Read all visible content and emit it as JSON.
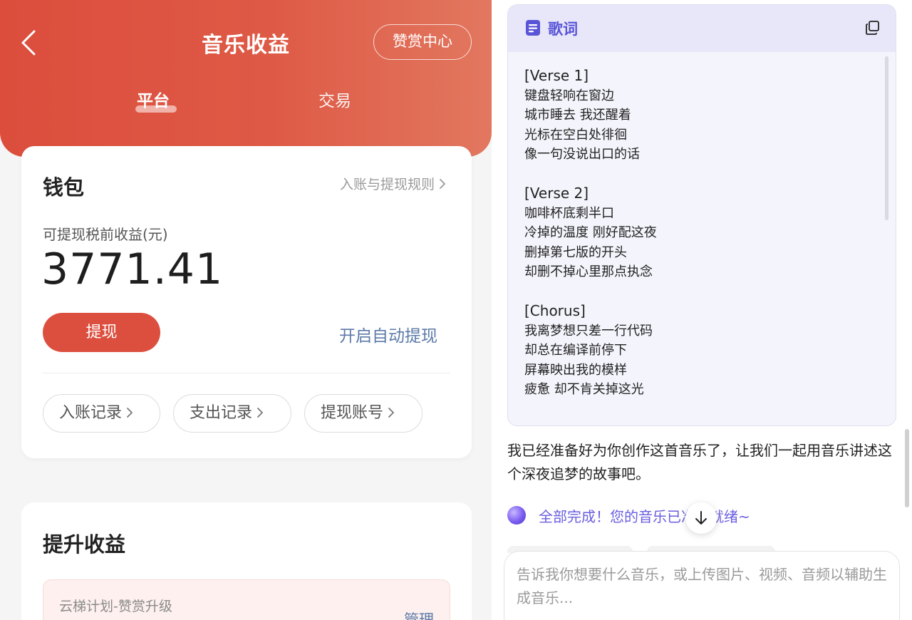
{
  "left": {
    "header": {
      "title": "音乐收益",
      "center_button": "赞赏中心",
      "tabs": [
        {
          "label": "平台",
          "active": true
        },
        {
          "label": "交易",
          "active": false
        }
      ],
      "accent_color": "#dc4d3c"
    },
    "wallet": {
      "title": "钱包",
      "rules_link": "入账与提现规则",
      "earn_label": "可提现税前收益(元)",
      "amount": "3771.41",
      "withdraw_button": "提现",
      "auto_withdraw_link": "开启自动提现",
      "records": [
        {
          "label": "入账记录"
        },
        {
          "label": "支出记录"
        },
        {
          "label": "提现账号"
        }
      ]
    },
    "boost": {
      "title": "提升收益",
      "card_label": "云梯计划-赞赏升级",
      "manage_label": "管理"
    }
  },
  "right": {
    "lyrics": {
      "title": "歌词",
      "sections": [
        {
          "tag": "[Verse 1]",
          "lines": [
            "键盘轻响在窗边",
            "城市睡去 我还醒着",
            "光标在空白处徘徊",
            "像一句没说出口的话"
          ]
        },
        {
          "tag": "[Verse 2]",
          "lines": [
            "咖啡杯底剩半口",
            "冷掉的温度 刚好配这夜",
            "删掉第七版的开头",
            "却删不掉心里那点执念"
          ]
        },
        {
          "tag": "[Chorus]",
          "lines": [
            "我离梦想只差一行代码",
            "却总在编译前停下",
            "屏幕映出我的模样",
            "疲惫 却不肯关掉这光"
          ]
        }
      ]
    },
    "bot_message": "我已经准备好为你创作这首音乐了，让我们一起用音乐讲述这个深夜追梦的故事吧。",
    "status_text": "全部完成！您的音乐已准备就绪~",
    "input_placeholder": "告诉我你想要什么音乐，或上传图片、视频、音频以辅助生成音乐..."
  }
}
